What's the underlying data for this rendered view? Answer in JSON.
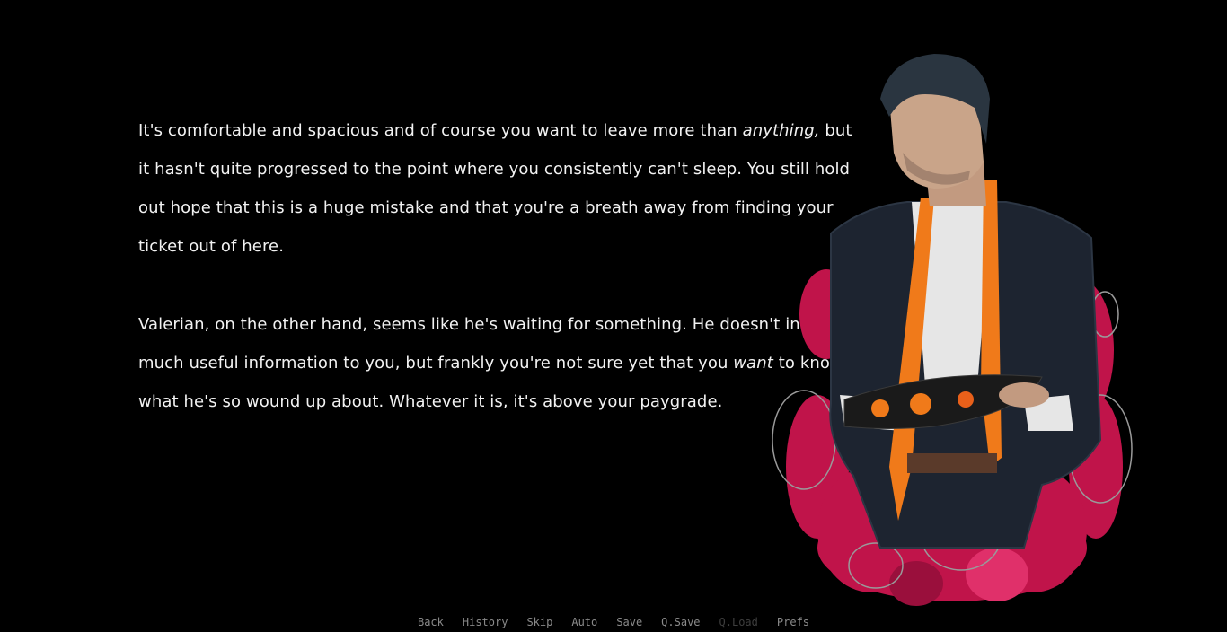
{
  "narration": {
    "p1": {
      "a": "It's comfortable and spacious and of course you want to leave more than ",
      "em": "anything,",
      "b": " but it hasn't quite progressed to the point where you consistently can't sleep. You still hold out hope that this is a huge mistake and that you're a breath away from finding your ticket out of here."
    },
    "p2": {
      "a": "Valerian, on the other hand, seems like he's waiting for something. He doesn't indulge much useful information to you, but frankly you're not sure yet that you ",
      "em": "want",
      "b": " to know what he's so wound up about. Whatever it is, it's above your paygrade."
    }
  },
  "character": {
    "icon": "character-portrait-valerian"
  },
  "quick_menu": {
    "back": "Back",
    "history": "History",
    "skip": "Skip",
    "auto": "Auto",
    "save": "Save",
    "qsave": "Q.Save",
    "qload": "Q.Load",
    "prefs": "Prefs"
  },
  "colors": {
    "background": "#000000",
    "text": "#f2f2f2",
    "menu": "#8a8a8a",
    "menu_disabled": "#3e3e3e",
    "accent_orange": "#f07a1a",
    "accent_crimson": "#c0144a"
  }
}
